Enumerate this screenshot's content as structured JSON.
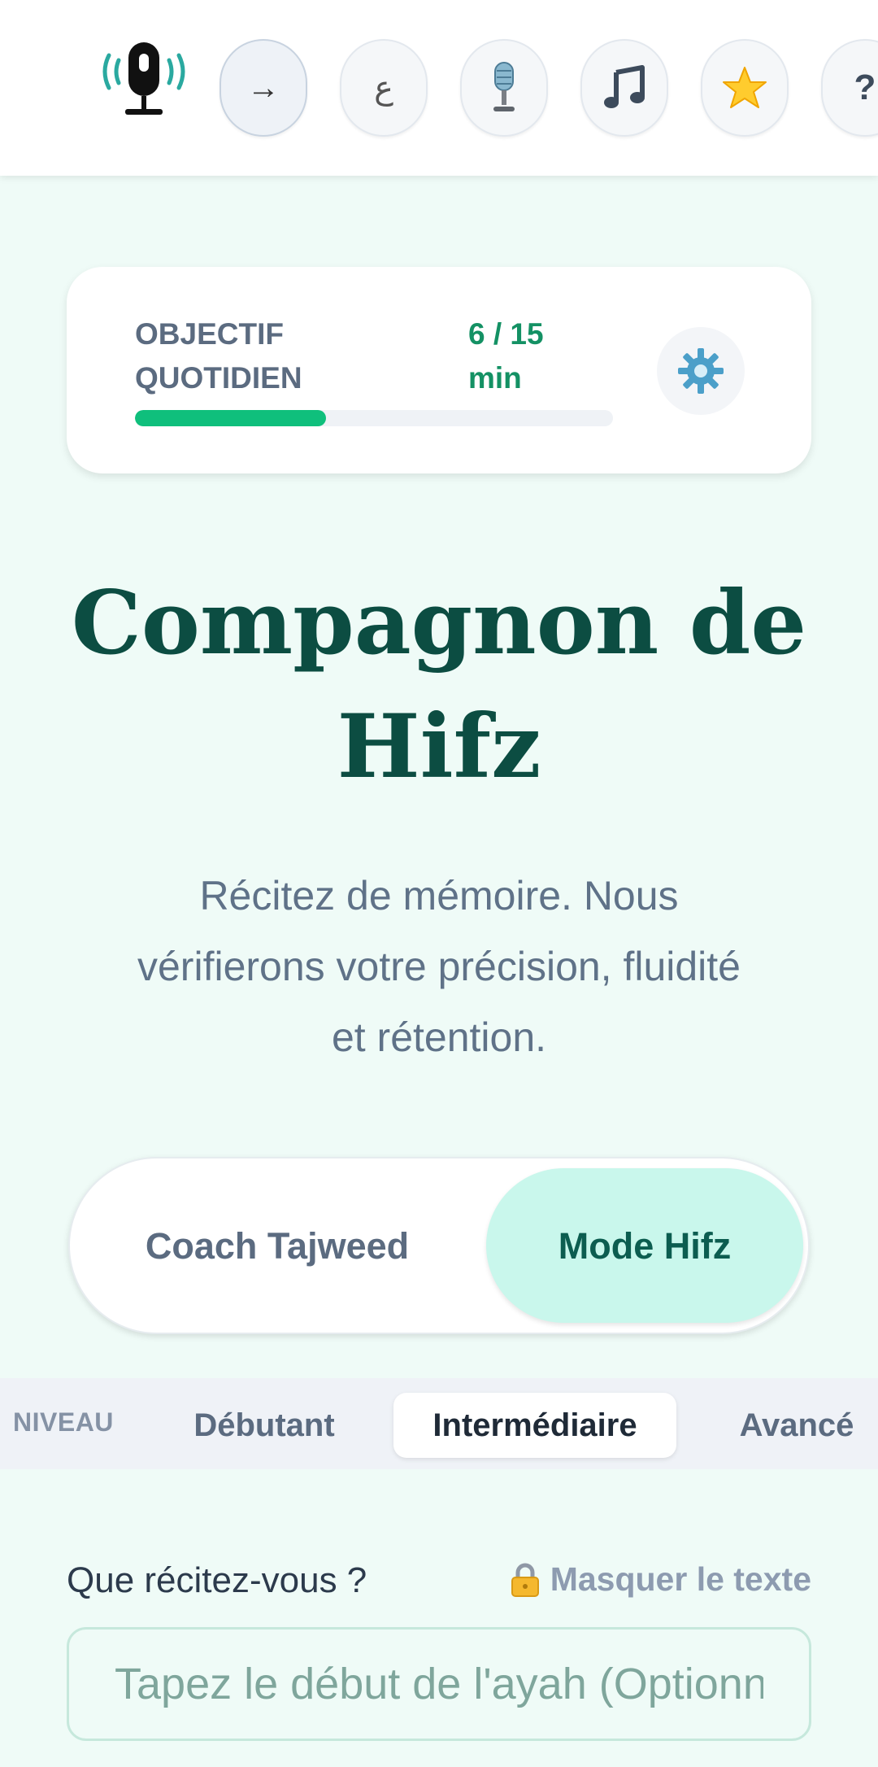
{
  "nav": {
    "logo_icon": "broadcasting-microphone-icon",
    "buttons": [
      {
        "name": "arrow-right-icon",
        "glyph": "→"
      },
      {
        "name": "arabic-letter-ain-icon",
        "glyph": "ع"
      },
      {
        "name": "studio-microphone-icon",
        "glyph": ""
      },
      {
        "name": "music-notes-icon",
        "glyph": ""
      },
      {
        "name": "star-icon",
        "glyph": ""
      },
      {
        "name": "help-question-icon",
        "glyph": "?"
      }
    ]
  },
  "goal": {
    "label": "OBJECTIF QUOTIDIEN",
    "value": "6 / 15 min",
    "progress_fraction": 0.4,
    "settings_icon": "gear-icon"
  },
  "hero": {
    "title": "Compagnon de Hifz",
    "subtitle": "Récitez de mémoire. Nous vérifierons votre précision, fluidité et rétention."
  },
  "mode": {
    "options": [
      "Coach Tajweed",
      "Mode Hifz"
    ],
    "selected": "Mode Hifz"
  },
  "level": {
    "label": "NIVEAU",
    "options": [
      "Débutant",
      "Intermédiaire",
      "Avancé"
    ],
    "selected": "Intermédiaire"
  },
  "recitation": {
    "label": "Que récitez-vous ?",
    "mask_label": "Masquer le texte",
    "lock_icon": "lock-icon",
    "placeholder": "Tapez le début de l'ayah (Optionnel)"
  },
  "colors": {
    "accent_green": "#0fbf7c",
    "title_green": "#0c4d42",
    "selected_mode_bg": "#c9f7ec"
  }
}
